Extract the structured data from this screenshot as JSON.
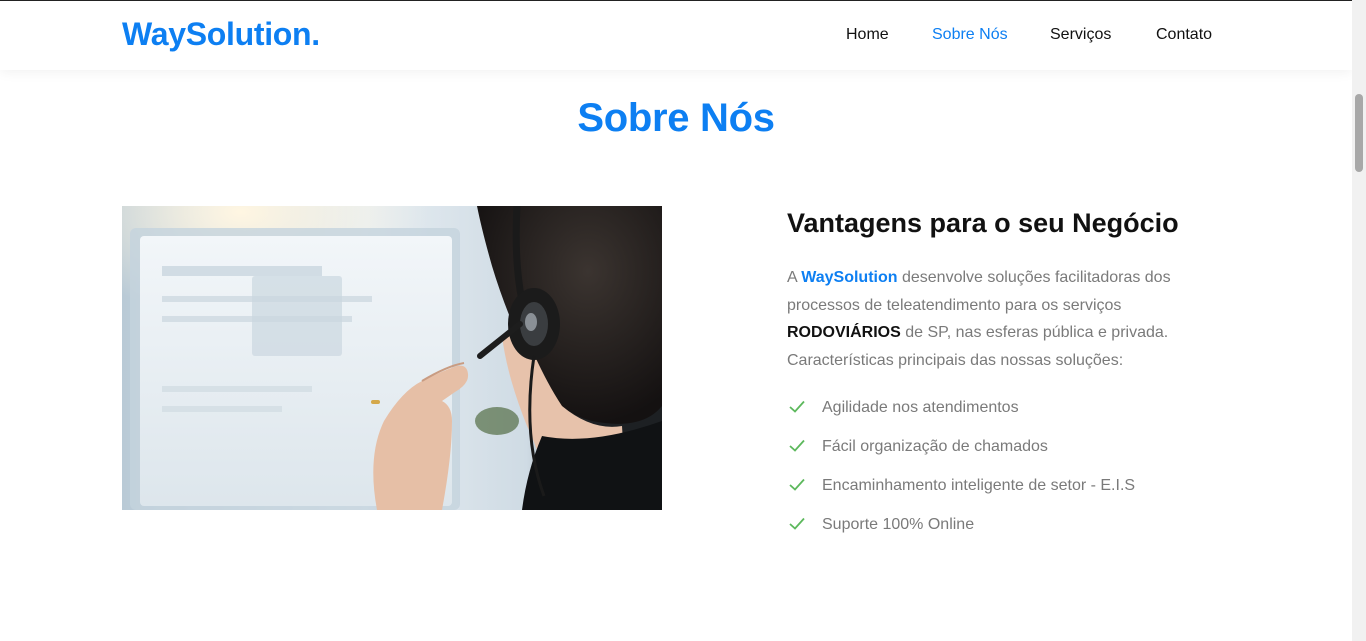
{
  "header": {
    "logo": "WaySolution.",
    "nav": [
      {
        "label": "Home",
        "active": false
      },
      {
        "label": "Sobre Nós",
        "active": true
      },
      {
        "label": "Serviços",
        "active": false
      },
      {
        "label": "Contato",
        "active": false
      }
    ]
  },
  "about": {
    "title": "Sobre Nós",
    "subtitle": "Vantagens para o seu Negócio",
    "paragraph": {
      "part1": "A ",
      "brand": "WaySolution",
      "part2": " desenvolve soluções facilitadoras dos processos de teleatendimento para os serviços ",
      "highlight": "RODOVIÁRIOS",
      "part3": " de SP, nas esferas pública e privada. Características principais das nossas soluções:"
    },
    "features": [
      "Agilidade nos atendimentos",
      "Fácil organização de chamados",
      "Encaminhamento inteligente de setor - E.I.S",
      "Suporte 100% Online"
    ],
    "image_icon": "photo-call-center-agent"
  },
  "colors": {
    "accent": "#0d7ff2",
    "check": "#5cb85c",
    "muted_text": "#7a7a7a"
  }
}
